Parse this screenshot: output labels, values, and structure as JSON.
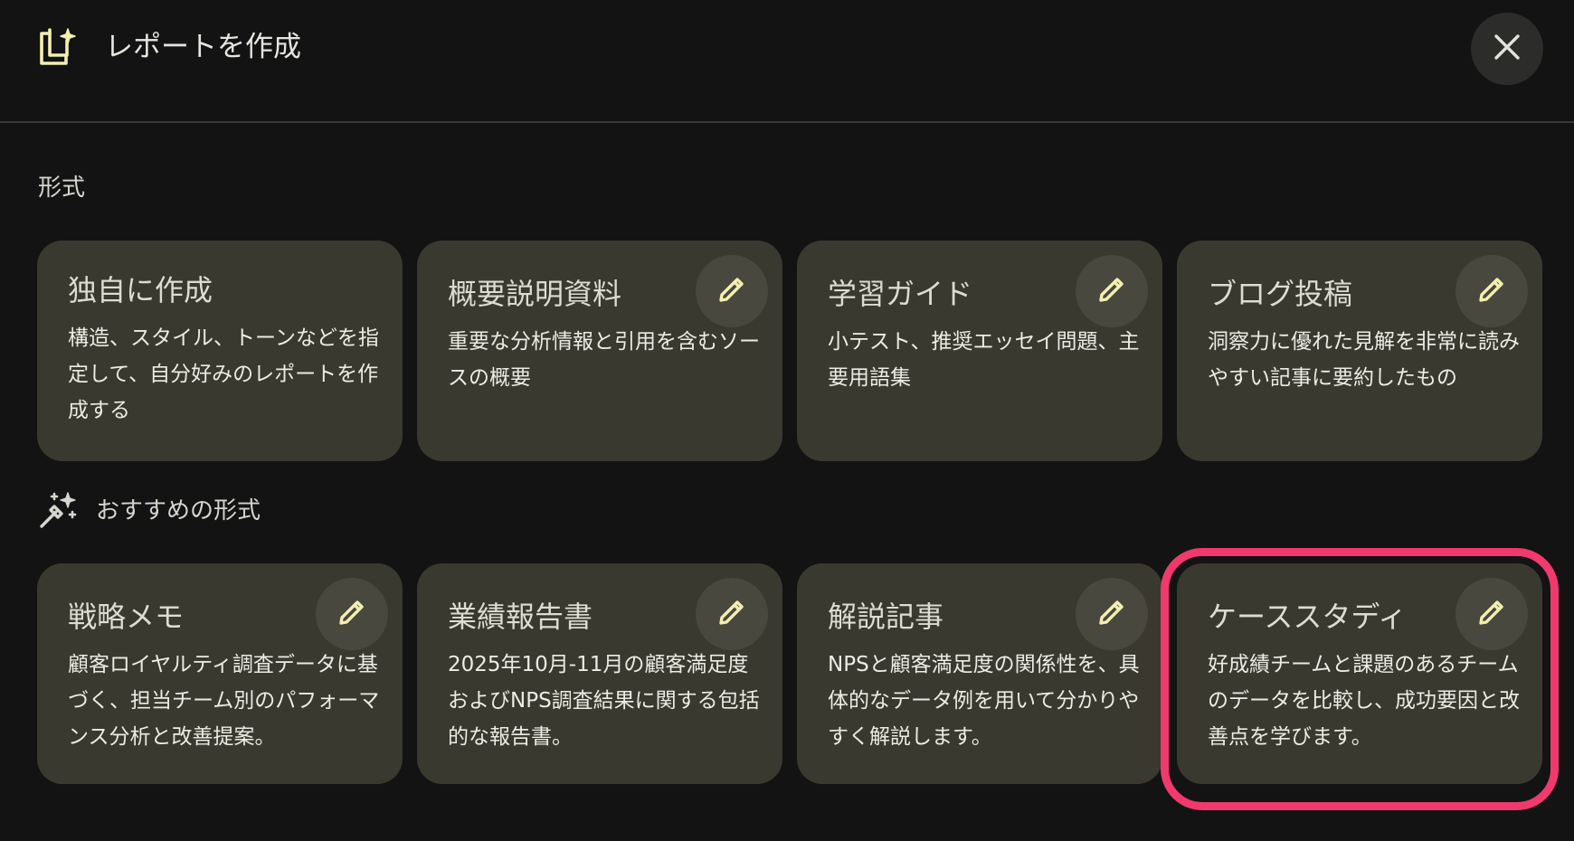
{
  "dialog": {
    "title": "レポートを作成",
    "header_icon": "report-sparkle-icon",
    "close_icon": "close-icon"
  },
  "formats": {
    "label": "形式",
    "cards": [
      {
        "title": "独自に作成",
        "description": "構造、スタイル、トーンなどを指定して、自分好みのレポートを作成する"
      },
      {
        "title": "概要説明資料",
        "description": "重要な分析情報と引用を含むソースの概要"
      },
      {
        "title": "学習ガイド",
        "description": "小テスト、推奨エッセイ問題、主要用語集"
      },
      {
        "title": "ブログ投稿",
        "description": "洞察力に優れた見解を非常に読みやすい記事に要約したもの"
      }
    ]
  },
  "suggested": {
    "label": "おすすめの形式",
    "icon": "magic-wand-icon",
    "cards": [
      {
        "title": "戦略メモ",
        "description": "顧客ロイヤルティ調査データに基づく、担当チーム別のパフォーマンス分析と改善提案。"
      },
      {
        "title": "業績報告書",
        "description": "2025年10月-11月の顧客満足度およびNPS調査結果に関する包括的な報告書。"
      },
      {
        "title": "解説記事",
        "description": "NPSと顧客満足度の関係性を、具体的なデータ例を用いて分かりやすく解説します。"
      },
      {
        "title": "ケーススタディ",
        "description": "好成績チームと課題のあるチームのデータを比較し、成功要因と改善点を学びます。"
      }
    ]
  },
  "edit_icon": "pencil-icon",
  "colors": {
    "background": "#131313",
    "card": "#39392f",
    "accent_icon": "#f3efb0",
    "highlight": "#f0396d"
  }
}
